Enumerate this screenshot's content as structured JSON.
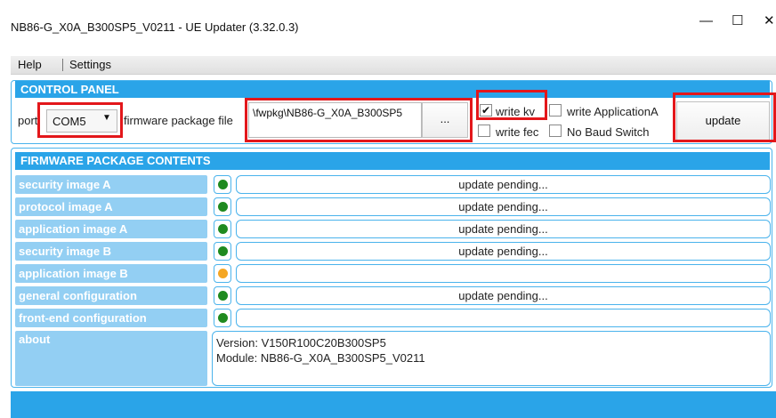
{
  "window": {
    "title": "NB86-G_X0A_B300SP5_V0211 - UE Updater (3.32.0.3)",
    "minimize_glyph": "—",
    "maximize_glyph": "☐",
    "close_glyph": "✕"
  },
  "menu": {
    "items": [
      "Help",
      "Settings"
    ]
  },
  "control_panel": {
    "header": "CONTROL PANEL",
    "port_label": "port",
    "port_value": "COM5",
    "firmware_label": "firmware package file",
    "firmware_value": "\\fwpkg\\NB86-G_X0A_B300SP5",
    "browse_label": "...",
    "write_kv_label": "write kv",
    "write_kv_checked": true,
    "write_fec_label": "write fec",
    "write_fec_checked": false,
    "write_app_label": "write ApplicationA",
    "write_app_checked": false,
    "no_baud_label": "No Baud Switch",
    "no_baud_checked": false,
    "update_label": "update"
  },
  "firmware_contents": {
    "header": "FIRMWARE PACKAGE CONTENTS",
    "rows": [
      {
        "label": "security image A",
        "status": "update pending...",
        "indicator": "green"
      },
      {
        "label": "protocol image A",
        "status": "update pending...",
        "indicator": "green"
      },
      {
        "label": "application image A",
        "status": "update pending...",
        "indicator": "green"
      },
      {
        "label": "security image B",
        "status": "update pending...",
        "indicator": "green"
      },
      {
        "label": "application image B",
        "status": "",
        "indicator": "orange"
      },
      {
        "label": "general configuration",
        "status": "update pending...",
        "indicator": "green"
      },
      {
        "label": "front-end configuration",
        "status": "",
        "indicator": "green"
      }
    ],
    "about_label": "about",
    "about_version": "Version: V150R100C20B300SP5",
    "about_module": "Module: NB86-G_X0A_B300SP5_V0211"
  },
  "colors": {
    "accent": "#2aa4e8",
    "row_label_bg": "#93cff3",
    "indicator_green": "#1f8a1f",
    "indicator_orange": "#f5a623",
    "highlight_red": "#e3171b"
  }
}
